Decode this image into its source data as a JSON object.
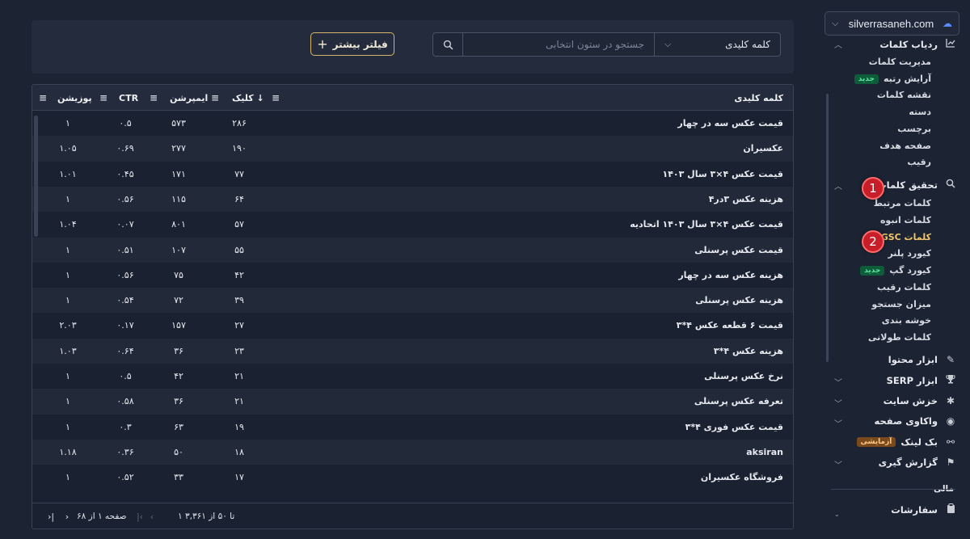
{
  "sidebar": {
    "domain": "silverrasaneh.com",
    "groups": {
      "tracker": {
        "title": "ردیاب کلمات",
        "items": [
          "مدیریت کلمات",
          "آرایش رتبه",
          "نقشه کلمات",
          "دسته",
          "برچسب",
          "صفحه هدف",
          "رقیب"
        ],
        "new_badge": "جدید"
      },
      "research": {
        "title": "تحقیق کلمات",
        "items": [
          "کلمات مرتبط",
          "کلمات انبوه",
          "کلمات GSC",
          "کیورد پلنر",
          "کیورد گپ",
          "کلمات رقیب",
          "میزان جستجو",
          "خوشه بندی",
          "کلمات طولانی"
        ],
        "new_badge": "جدید"
      },
      "content": "ابزار محتوا",
      "serp": "ابزار SERP",
      "crawl": "خزش سایت",
      "page_audit": "واکاوی صفحه",
      "backlink": {
        "title": "بک لینک",
        "badge": "آزمایشی"
      },
      "report": "گزارش گیری"
    },
    "section_finance": "مالی",
    "orders": "سفارشات",
    "steps": [
      "1",
      "2"
    ]
  },
  "search": {
    "column": "کلمه کلیدی",
    "placeholder": "جستجو در ستون انتخابی",
    "filter_label": "فیلتر بیشتر"
  },
  "table": {
    "headers": {
      "keyword": "کلمه کلیدی",
      "clicks": "کلیک ↓",
      "impressions": "ایمپرشن",
      "ctr": "CTR",
      "position": "پوزیشن"
    },
    "rows": [
      {
        "keyword": "قیمت عکس سه در چهار",
        "clicks": "۲۸۶",
        "impressions": "۵۷۳",
        "ctr": "۰.۵",
        "position": "۱"
      },
      {
        "keyword": "عکسیران",
        "clicks": "۱۹۰",
        "impressions": "۲۷۷",
        "ctr": "۰.۶۹",
        "position": "۱.۰۵"
      },
      {
        "keyword": "قیمت عکس ۴×۳ سال ۱۴۰۳",
        "clicks": "۷۷",
        "impressions": "۱۷۱",
        "ctr": "۰.۴۵",
        "position": "۱.۰۱"
      },
      {
        "keyword": "هزینه عکس ۳در۴",
        "clicks": "۶۴",
        "impressions": "۱۱۵",
        "ctr": "۰.۵۶",
        "position": "۱"
      },
      {
        "keyword": "قیمت عکس ۴×۳ سال ۱۴۰۳ اتحادیه",
        "clicks": "۵۷",
        "impressions": "۸۰۱",
        "ctr": "۰.۰۷",
        "position": "۱.۰۴"
      },
      {
        "keyword": "قیمت عکس پرسنلی",
        "clicks": "۵۵",
        "impressions": "۱۰۷",
        "ctr": "۰.۵۱",
        "position": "۱"
      },
      {
        "keyword": "هزینه عکس سه در چهار",
        "clicks": "۴۲",
        "impressions": "۷۵",
        "ctr": "۰.۵۶",
        "position": "۱"
      },
      {
        "keyword": "هزینه عکس پرسنلی",
        "clicks": "۳۹",
        "impressions": "۷۲",
        "ctr": "۰.۵۴",
        "position": "۱"
      },
      {
        "keyword": "قیمت ۶ قطعه عکس ۴*۳",
        "clicks": "۲۷",
        "impressions": "۱۵۷",
        "ctr": "۰.۱۷",
        "position": "۲.۰۳"
      },
      {
        "keyword": "هزینه عکس ۴*۳",
        "clicks": "۲۳",
        "impressions": "۳۶",
        "ctr": "۰.۶۴",
        "position": "۱.۰۳"
      },
      {
        "keyword": "نرخ عکس پرسنلی",
        "clicks": "۲۱",
        "impressions": "۴۲",
        "ctr": "۰.۵",
        "position": "۱"
      },
      {
        "keyword": "تعرفه عکس پرسنلی",
        "clicks": "۲۱",
        "impressions": "۳۶",
        "ctr": "۰.۵۸",
        "position": "۱"
      },
      {
        "keyword": "قیمت عکس فوری ۴*۳",
        "clicks": "۱۹",
        "impressions": "۶۳",
        "ctr": "۰.۳",
        "position": "۱"
      },
      {
        "keyword": "aksiran",
        "clicks": "۱۸",
        "impressions": "۵۰",
        "ctr": "۰.۳۶",
        "position": "۱.۱۸"
      },
      {
        "keyword": "فروشگاه عکسیران",
        "clicks": "۱۷",
        "impressions": "۳۳",
        "ctr": "۰.۵۲",
        "position": "۱"
      }
    ],
    "footer": {
      "range": "۱ تا ۵۰ از ۳,۳۶۱",
      "page": "صفحه ۱ از ۶۸"
    }
  }
}
